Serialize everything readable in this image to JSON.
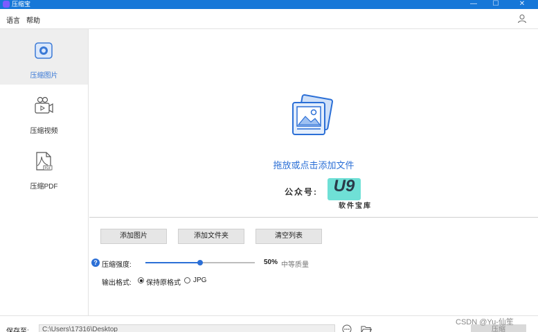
{
  "window": {
    "title": "压缩宝",
    "minimize": "—",
    "maximize": "☐",
    "close": "✕"
  },
  "menu": {
    "language": "语言",
    "help": "帮助"
  },
  "sidebar": {
    "items": [
      {
        "label": "压缩图片",
        "active": true
      },
      {
        "label": "压缩视频",
        "active": false
      },
      {
        "label": "压缩PDF",
        "active": false
      }
    ]
  },
  "dropzone": {
    "text": "拖放或点击添加文件",
    "watermark_label": "公众号:",
    "watermark_logo": "U9",
    "watermark_sub": "软件宝库"
  },
  "actions": {
    "add_images": "添加图片",
    "add_folder": "添加文件夹",
    "clear_list": "清空列表"
  },
  "settings": {
    "strength_label": "压缩强度:",
    "strength_value": "50%",
    "strength_fraction": 0.5,
    "strength_quality": "中等质量",
    "format_label": "输出格式:",
    "format_keep": "保持原格式",
    "format_jpg": "JPG",
    "selected_format": "keep"
  },
  "bottom": {
    "save_to_label": "保存至:",
    "save_path": "C:\\Users\\17316\\Desktop",
    "compress_button": "压缩"
  },
  "overlay": {
    "csdn_watermark": "CSDN @Yu-仙笙"
  },
  "colors": {
    "accent": "#2b6fd6",
    "titlebar": "#1677d8"
  }
}
